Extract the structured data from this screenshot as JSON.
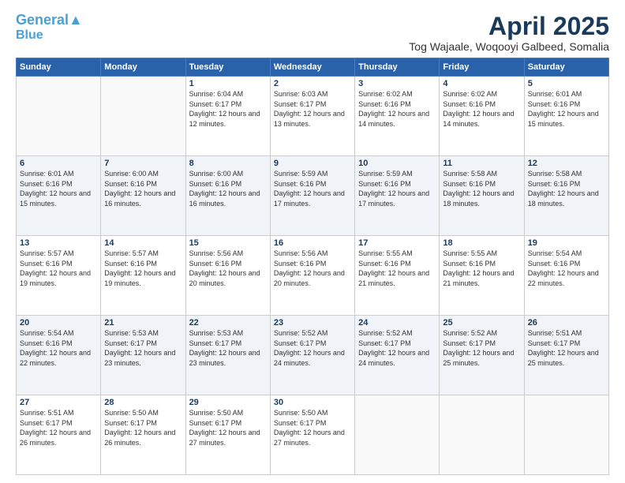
{
  "logo": {
    "line1": "General",
    "line2": "Blue"
  },
  "header": {
    "month": "April 2025",
    "location": "Tog Wajaale, Woqooyi Galbeed, Somalia"
  },
  "days_of_week": [
    "Sunday",
    "Monday",
    "Tuesday",
    "Wednesday",
    "Thursday",
    "Friday",
    "Saturday"
  ],
  "weeks": [
    [
      {
        "num": "",
        "sunrise": "",
        "sunset": "",
        "daylight": ""
      },
      {
        "num": "",
        "sunrise": "",
        "sunset": "",
        "daylight": ""
      },
      {
        "num": "1",
        "sunrise": "Sunrise: 6:04 AM",
        "sunset": "Sunset: 6:17 PM",
        "daylight": "Daylight: 12 hours and 12 minutes."
      },
      {
        "num": "2",
        "sunrise": "Sunrise: 6:03 AM",
        "sunset": "Sunset: 6:17 PM",
        "daylight": "Daylight: 12 hours and 13 minutes."
      },
      {
        "num": "3",
        "sunrise": "Sunrise: 6:02 AM",
        "sunset": "Sunset: 6:16 PM",
        "daylight": "Daylight: 12 hours and 14 minutes."
      },
      {
        "num": "4",
        "sunrise": "Sunrise: 6:02 AM",
        "sunset": "Sunset: 6:16 PM",
        "daylight": "Daylight: 12 hours and 14 minutes."
      },
      {
        "num": "5",
        "sunrise": "Sunrise: 6:01 AM",
        "sunset": "Sunset: 6:16 PM",
        "daylight": "Daylight: 12 hours and 15 minutes."
      }
    ],
    [
      {
        "num": "6",
        "sunrise": "Sunrise: 6:01 AM",
        "sunset": "Sunset: 6:16 PM",
        "daylight": "Daylight: 12 hours and 15 minutes."
      },
      {
        "num": "7",
        "sunrise": "Sunrise: 6:00 AM",
        "sunset": "Sunset: 6:16 PM",
        "daylight": "Daylight: 12 hours and 16 minutes."
      },
      {
        "num": "8",
        "sunrise": "Sunrise: 6:00 AM",
        "sunset": "Sunset: 6:16 PM",
        "daylight": "Daylight: 12 hours and 16 minutes."
      },
      {
        "num": "9",
        "sunrise": "Sunrise: 5:59 AM",
        "sunset": "Sunset: 6:16 PM",
        "daylight": "Daylight: 12 hours and 17 minutes."
      },
      {
        "num": "10",
        "sunrise": "Sunrise: 5:59 AM",
        "sunset": "Sunset: 6:16 PM",
        "daylight": "Daylight: 12 hours and 17 minutes."
      },
      {
        "num": "11",
        "sunrise": "Sunrise: 5:58 AM",
        "sunset": "Sunset: 6:16 PM",
        "daylight": "Daylight: 12 hours and 18 minutes."
      },
      {
        "num": "12",
        "sunrise": "Sunrise: 5:58 AM",
        "sunset": "Sunset: 6:16 PM",
        "daylight": "Daylight: 12 hours and 18 minutes."
      }
    ],
    [
      {
        "num": "13",
        "sunrise": "Sunrise: 5:57 AM",
        "sunset": "Sunset: 6:16 PM",
        "daylight": "Daylight: 12 hours and 19 minutes."
      },
      {
        "num": "14",
        "sunrise": "Sunrise: 5:57 AM",
        "sunset": "Sunset: 6:16 PM",
        "daylight": "Daylight: 12 hours and 19 minutes."
      },
      {
        "num": "15",
        "sunrise": "Sunrise: 5:56 AM",
        "sunset": "Sunset: 6:16 PM",
        "daylight": "Daylight: 12 hours and 20 minutes."
      },
      {
        "num": "16",
        "sunrise": "Sunrise: 5:56 AM",
        "sunset": "Sunset: 6:16 PM",
        "daylight": "Daylight: 12 hours and 20 minutes."
      },
      {
        "num": "17",
        "sunrise": "Sunrise: 5:55 AM",
        "sunset": "Sunset: 6:16 PM",
        "daylight": "Daylight: 12 hours and 21 minutes."
      },
      {
        "num": "18",
        "sunrise": "Sunrise: 5:55 AM",
        "sunset": "Sunset: 6:16 PM",
        "daylight": "Daylight: 12 hours and 21 minutes."
      },
      {
        "num": "19",
        "sunrise": "Sunrise: 5:54 AM",
        "sunset": "Sunset: 6:16 PM",
        "daylight": "Daylight: 12 hours and 22 minutes."
      }
    ],
    [
      {
        "num": "20",
        "sunrise": "Sunrise: 5:54 AM",
        "sunset": "Sunset: 6:16 PM",
        "daylight": "Daylight: 12 hours and 22 minutes."
      },
      {
        "num": "21",
        "sunrise": "Sunrise: 5:53 AM",
        "sunset": "Sunset: 6:17 PM",
        "daylight": "Daylight: 12 hours and 23 minutes."
      },
      {
        "num": "22",
        "sunrise": "Sunrise: 5:53 AM",
        "sunset": "Sunset: 6:17 PM",
        "daylight": "Daylight: 12 hours and 23 minutes."
      },
      {
        "num": "23",
        "sunrise": "Sunrise: 5:52 AM",
        "sunset": "Sunset: 6:17 PM",
        "daylight": "Daylight: 12 hours and 24 minutes."
      },
      {
        "num": "24",
        "sunrise": "Sunrise: 5:52 AM",
        "sunset": "Sunset: 6:17 PM",
        "daylight": "Daylight: 12 hours and 24 minutes."
      },
      {
        "num": "25",
        "sunrise": "Sunrise: 5:52 AM",
        "sunset": "Sunset: 6:17 PM",
        "daylight": "Daylight: 12 hours and 25 minutes."
      },
      {
        "num": "26",
        "sunrise": "Sunrise: 5:51 AM",
        "sunset": "Sunset: 6:17 PM",
        "daylight": "Daylight: 12 hours and 25 minutes."
      }
    ],
    [
      {
        "num": "27",
        "sunrise": "Sunrise: 5:51 AM",
        "sunset": "Sunset: 6:17 PM",
        "daylight": "Daylight: 12 hours and 26 minutes."
      },
      {
        "num": "28",
        "sunrise": "Sunrise: 5:50 AM",
        "sunset": "Sunset: 6:17 PM",
        "daylight": "Daylight: 12 hours and 26 minutes."
      },
      {
        "num": "29",
        "sunrise": "Sunrise: 5:50 AM",
        "sunset": "Sunset: 6:17 PM",
        "daylight": "Daylight: 12 hours and 27 minutes."
      },
      {
        "num": "30",
        "sunrise": "Sunrise: 5:50 AM",
        "sunset": "Sunset: 6:17 PM",
        "daylight": "Daylight: 12 hours and 27 minutes."
      },
      {
        "num": "",
        "sunrise": "",
        "sunset": "",
        "daylight": ""
      },
      {
        "num": "",
        "sunrise": "",
        "sunset": "",
        "daylight": ""
      },
      {
        "num": "",
        "sunrise": "",
        "sunset": "",
        "daylight": ""
      }
    ]
  ]
}
